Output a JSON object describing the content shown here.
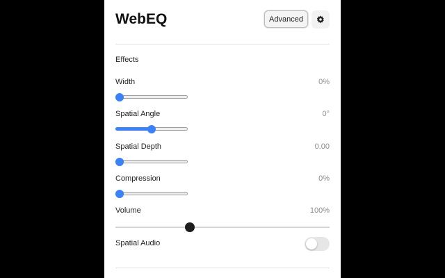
{
  "header": {
    "title": "WebEQ",
    "advanced_label": "Advanced",
    "settings_icon": "gear-icon"
  },
  "effects": {
    "section_label": "Effects",
    "sliders": [
      {
        "label": "Width",
        "value": "0%",
        "fraction": 0.0
      },
      {
        "label": "Spatial Angle",
        "value": "0°",
        "fraction": 0.5
      },
      {
        "label": "Spatial Depth",
        "value": "0.00",
        "fraction": 0.0
      },
      {
        "label": "Compression",
        "value": "0%",
        "fraction": 0.0
      }
    ],
    "volume": {
      "label": "Volume",
      "value": "100%",
      "fraction": 0.34
    },
    "spatial_audio": {
      "label": "Spatial Audio",
      "enabled": false
    }
  },
  "colors": {
    "accent": "#3b82f6",
    "volume_thumb": "#1e1e1e",
    "panel_bg": "#ffffff",
    "backdrop": "#000000"
  }
}
